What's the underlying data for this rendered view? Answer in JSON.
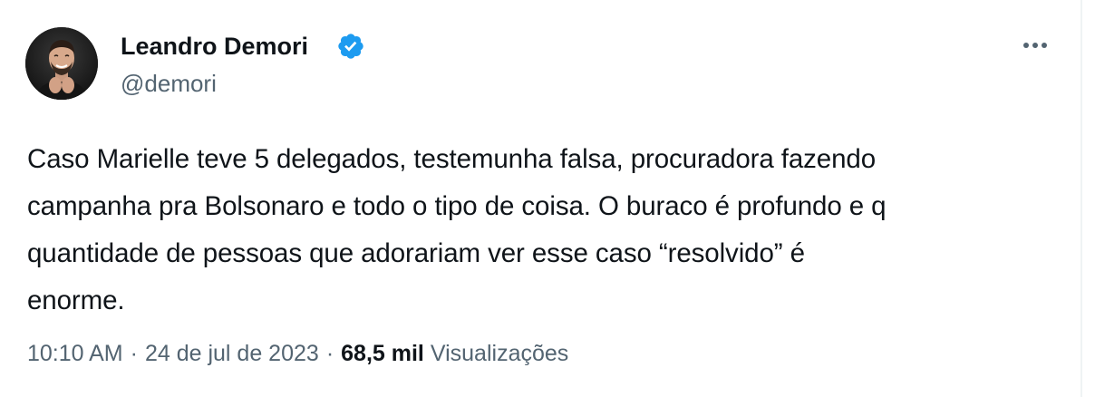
{
  "author": {
    "display_name": "Leandro Demori",
    "handle": "@demori",
    "verified": true,
    "verified_color": "#1d9bf0",
    "avatar_icon": "avatar-photo"
  },
  "tweet": {
    "text": "Caso Marielle teve 5 delegados, testemunha falsa, procuradora fazendo\ncampanha pra Bolsonaro e todo o tipo de coisa. O buraco é profundo e q\nquantidade de pessoas que adorariam ver esse caso “resolvido” é\nenorme."
  },
  "meta": {
    "time": "10:10 AM",
    "separator": "·",
    "date": "24 de jul de 2023",
    "views_count": "68,5 mil",
    "views_label": "Visualizações"
  },
  "menu": {
    "icon": "more-horizontal-icon"
  }
}
